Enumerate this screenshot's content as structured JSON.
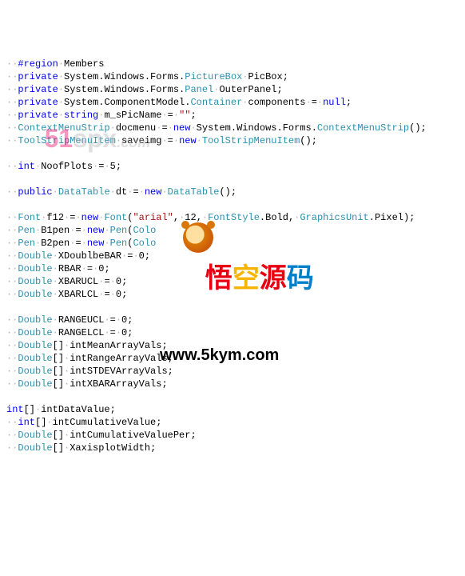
{
  "code": {
    "lines": [
      [
        [
          "ws",
          "··"
        ],
        [
          "pp",
          "#region"
        ],
        [
          "ws",
          "·"
        ],
        [
          "id",
          "Members"
        ]
      ],
      [
        [
          "ws",
          "··"
        ],
        [
          "kw",
          "private"
        ],
        [
          "ws",
          "·"
        ],
        [
          "id",
          "System.Windows.Forms."
        ],
        [
          "tp",
          "PictureBox"
        ],
        [
          "ws",
          "·"
        ],
        [
          "id",
          "PicBox"
        ],
        [
          "pn",
          ";"
        ]
      ],
      [
        [
          "ws",
          "··"
        ],
        [
          "kw",
          "private"
        ],
        [
          "ws",
          "·"
        ],
        [
          "id",
          "System.Windows.Forms."
        ],
        [
          "tp",
          "Panel"
        ],
        [
          "ws",
          "·"
        ],
        [
          "id",
          "OuterPanel"
        ],
        [
          "pn",
          ";"
        ]
      ],
      [
        [
          "ws",
          "··"
        ],
        [
          "kw",
          "private"
        ],
        [
          "ws",
          "·"
        ],
        [
          "id",
          "System.ComponentModel."
        ],
        [
          "tp",
          "Container"
        ],
        [
          "ws",
          "·"
        ],
        [
          "id",
          "components"
        ],
        [
          "ws",
          "·"
        ],
        [
          "pn",
          "="
        ],
        [
          "ws",
          "·"
        ],
        [
          "kw",
          "null"
        ],
        [
          "pn",
          ";"
        ]
      ],
      [
        [
          "ws",
          "··"
        ],
        [
          "kw",
          "private"
        ],
        [
          "ws",
          "·"
        ],
        [
          "kw",
          "string"
        ],
        [
          "ws",
          "·"
        ],
        [
          "id",
          "m_sPicName"
        ],
        [
          "ws",
          "·"
        ],
        [
          "pn",
          "="
        ],
        [
          "ws",
          "·"
        ],
        [
          "str",
          "\"\""
        ],
        [
          "pn",
          ";"
        ]
      ],
      [
        [
          "ws",
          "··"
        ],
        [
          "tp",
          "ContextMenuStrip"
        ],
        [
          "ws",
          "·"
        ],
        [
          "id",
          "docmenu"
        ],
        [
          "ws",
          "·"
        ],
        [
          "pn",
          "="
        ],
        [
          "ws",
          "·"
        ],
        [
          "kw",
          "new"
        ],
        [
          "ws",
          "·"
        ],
        [
          "id",
          "System.Windows.Forms."
        ],
        [
          "tp",
          "ContextMenuStrip"
        ],
        [
          "pn",
          "();"
        ]
      ],
      [
        [
          "ws",
          "··"
        ],
        [
          "tp",
          "ToolStripMenuItem"
        ],
        [
          "ws",
          "·"
        ],
        [
          "id",
          "saveimg"
        ],
        [
          "ws",
          "·"
        ],
        [
          "pn",
          "="
        ],
        [
          "ws",
          "·"
        ],
        [
          "kw",
          "new"
        ],
        [
          "ws",
          "·"
        ],
        [
          "tp",
          "ToolStripMenuItem"
        ],
        [
          "pn",
          "();"
        ]
      ],
      [],
      [
        [
          "ws",
          "··"
        ],
        [
          "kw",
          "int"
        ],
        [
          "ws",
          "·"
        ],
        [
          "id",
          "NoofPlots"
        ],
        [
          "ws",
          "·"
        ],
        [
          "pn",
          "="
        ],
        [
          "ws",
          "·"
        ],
        [
          "num",
          "5"
        ],
        [
          "pn",
          ";"
        ]
      ],
      [],
      [
        [
          "ws",
          "··"
        ],
        [
          "kw",
          "public"
        ],
        [
          "ws",
          "·"
        ],
        [
          "tp",
          "DataTable"
        ],
        [
          "ws",
          "·"
        ],
        [
          "id",
          "dt"
        ],
        [
          "ws",
          "·"
        ],
        [
          "pn",
          "="
        ],
        [
          "ws",
          "·"
        ],
        [
          "kw",
          "new"
        ],
        [
          "ws",
          "·"
        ],
        [
          "tp",
          "DataTable"
        ],
        [
          "pn",
          "();"
        ]
      ],
      [],
      [
        [
          "ws",
          "··"
        ],
        [
          "tp",
          "Font"
        ],
        [
          "ws",
          "·"
        ],
        [
          "id",
          "f12"
        ],
        [
          "ws",
          "·"
        ],
        [
          "pn",
          "="
        ],
        [
          "ws",
          "·"
        ],
        [
          "kw",
          "new"
        ],
        [
          "ws",
          "·"
        ],
        [
          "tp",
          "Font"
        ],
        [
          "pn",
          "("
        ],
        [
          "str",
          "\"arial\""
        ],
        [
          "pn",
          ","
        ],
        [
          "ws",
          "·"
        ],
        [
          "num",
          "12"
        ],
        [
          "pn",
          ","
        ],
        [
          "ws",
          "·"
        ],
        [
          "tp",
          "FontStyle"
        ],
        [
          "pn",
          "."
        ],
        [
          "id",
          "Bold"
        ],
        [
          "pn",
          ","
        ],
        [
          "ws",
          "·"
        ],
        [
          "tp",
          "GraphicsUnit"
        ],
        [
          "pn",
          "."
        ],
        [
          "id",
          "Pixel"
        ],
        [
          "pn",
          ");"
        ]
      ],
      [
        [
          "ws",
          "··"
        ],
        [
          "tp",
          "Pen"
        ],
        [
          "ws",
          "·"
        ],
        [
          "id",
          "B1pen"
        ],
        [
          "ws",
          "·"
        ],
        [
          "pn",
          "="
        ],
        [
          "ws",
          "·"
        ],
        [
          "kw",
          "new"
        ],
        [
          "ws",
          "·"
        ],
        [
          "tp",
          "Pen"
        ],
        [
          "pn",
          "("
        ],
        [
          "tp",
          "Colo"
        ]
      ],
      [
        [
          "ws",
          "··"
        ],
        [
          "tp",
          "Pen"
        ],
        [
          "ws",
          "·"
        ],
        [
          "id",
          "B2pen"
        ],
        [
          "ws",
          "·"
        ],
        [
          "pn",
          "="
        ],
        [
          "ws",
          "·"
        ],
        [
          "kw",
          "new"
        ],
        [
          "ws",
          "·"
        ],
        [
          "tp",
          "Pen"
        ],
        [
          "pn",
          "("
        ],
        [
          "tp",
          "Colo"
        ]
      ],
      [
        [
          "ws",
          "··"
        ],
        [
          "tp",
          "Double"
        ],
        [
          "ws",
          "·"
        ],
        [
          "id",
          "XDoublbeBAR"
        ],
        [
          "ws",
          "·"
        ],
        [
          "pn",
          "="
        ],
        [
          "ws",
          "·"
        ],
        [
          "num",
          "0"
        ],
        [
          "pn",
          ";"
        ]
      ],
      [
        [
          "ws",
          "··"
        ],
        [
          "tp",
          "Double"
        ],
        [
          "ws",
          "·"
        ],
        [
          "id",
          "RBAR"
        ],
        [
          "ws",
          "·"
        ],
        [
          "pn",
          "="
        ],
        [
          "ws",
          "·"
        ],
        [
          "num",
          "0"
        ],
        [
          "pn",
          ";"
        ]
      ],
      [
        [
          "ws",
          "··"
        ],
        [
          "tp",
          "Double"
        ],
        [
          "ws",
          "·"
        ],
        [
          "id",
          "XBARUCL"
        ],
        [
          "ws",
          "·"
        ],
        [
          "pn",
          "="
        ],
        [
          "ws",
          "·"
        ],
        [
          "num",
          "0"
        ],
        [
          "pn",
          ";"
        ]
      ],
      [
        [
          "ws",
          "··"
        ],
        [
          "tp",
          "Double"
        ],
        [
          "ws",
          "·"
        ],
        [
          "id",
          "XBARLCL"
        ],
        [
          "ws",
          "·"
        ],
        [
          "pn",
          "="
        ],
        [
          "ws",
          "·"
        ],
        [
          "num",
          "0"
        ],
        [
          "pn",
          ";"
        ]
      ],
      [],
      [
        [
          "ws",
          "··"
        ],
        [
          "tp",
          "Double"
        ],
        [
          "ws",
          "·"
        ],
        [
          "id",
          "RANGEUCL"
        ],
        [
          "ws",
          "·"
        ],
        [
          "pn",
          "="
        ],
        [
          "ws",
          "·"
        ],
        [
          "num",
          "0"
        ],
        [
          "pn",
          ";"
        ]
      ],
      [
        [
          "ws",
          "··"
        ],
        [
          "tp",
          "Double"
        ],
        [
          "ws",
          "·"
        ],
        [
          "id",
          "RANGELCL"
        ],
        [
          "ws",
          "·"
        ],
        [
          "pn",
          "="
        ],
        [
          "ws",
          "·"
        ],
        [
          "num",
          "0"
        ],
        [
          "pn",
          ";"
        ]
      ],
      [
        [
          "ws",
          "··"
        ],
        [
          "tp",
          "Double"
        ],
        [
          "pn",
          "[]"
        ],
        [
          "ws",
          "·"
        ],
        [
          "id",
          "intMeanArrayVals"
        ],
        [
          "pn",
          ";"
        ]
      ],
      [
        [
          "ws",
          "··"
        ],
        [
          "tp",
          "Double"
        ],
        [
          "pn",
          "[]"
        ],
        [
          "ws",
          "·"
        ],
        [
          "id",
          "intRangeArrayVals"
        ],
        [
          "pn",
          ";"
        ]
      ],
      [
        [
          "ws",
          "··"
        ],
        [
          "tp",
          "Double"
        ],
        [
          "pn",
          "[]"
        ],
        [
          "ws",
          "·"
        ],
        [
          "id",
          "intSTDEVArrayVals"
        ],
        [
          "pn",
          ";"
        ]
      ],
      [
        [
          "ws",
          "··"
        ],
        [
          "tp",
          "Double"
        ],
        [
          "pn",
          "[]"
        ],
        [
          "ws",
          "·"
        ],
        [
          "id",
          "intXBARArrayVals"
        ],
        [
          "pn",
          ";"
        ]
      ],
      [],
      [
        [
          "kw",
          "int"
        ],
        [
          "pn",
          "[]"
        ],
        [
          "ws",
          "·"
        ],
        [
          "id",
          "intDataValue"
        ],
        [
          "pn",
          ";"
        ]
      ],
      [
        [
          "ws",
          "··"
        ],
        [
          "kw",
          "int"
        ],
        [
          "pn",
          "[]"
        ],
        [
          "ws",
          "·"
        ],
        [
          "id",
          "intCumulativeValue"
        ],
        [
          "pn",
          ";"
        ]
      ],
      [
        [
          "ws",
          "··"
        ],
        [
          "tp",
          "Double"
        ],
        [
          "pn",
          "[]"
        ],
        [
          "ws",
          "·"
        ],
        [
          "id",
          "intCumulativeValuePer"
        ],
        [
          "pn",
          ";"
        ]
      ],
      [
        [
          "ws",
          "··"
        ],
        [
          "tp",
          "Double"
        ],
        [
          "pn",
          "[]"
        ],
        [
          "ws",
          "·"
        ],
        [
          "id",
          "XaxisplotWidth"
        ],
        [
          "pn",
          ";"
        ]
      ]
    ]
  },
  "watermark1": {
    "left": "51",
    "right": "spx",
    "suffix": ".com"
  },
  "watermark2": {
    "c1": "悟",
    "c2": "空",
    "c3": "源",
    "c4": "码",
    "url": "www.5kym.com"
  }
}
